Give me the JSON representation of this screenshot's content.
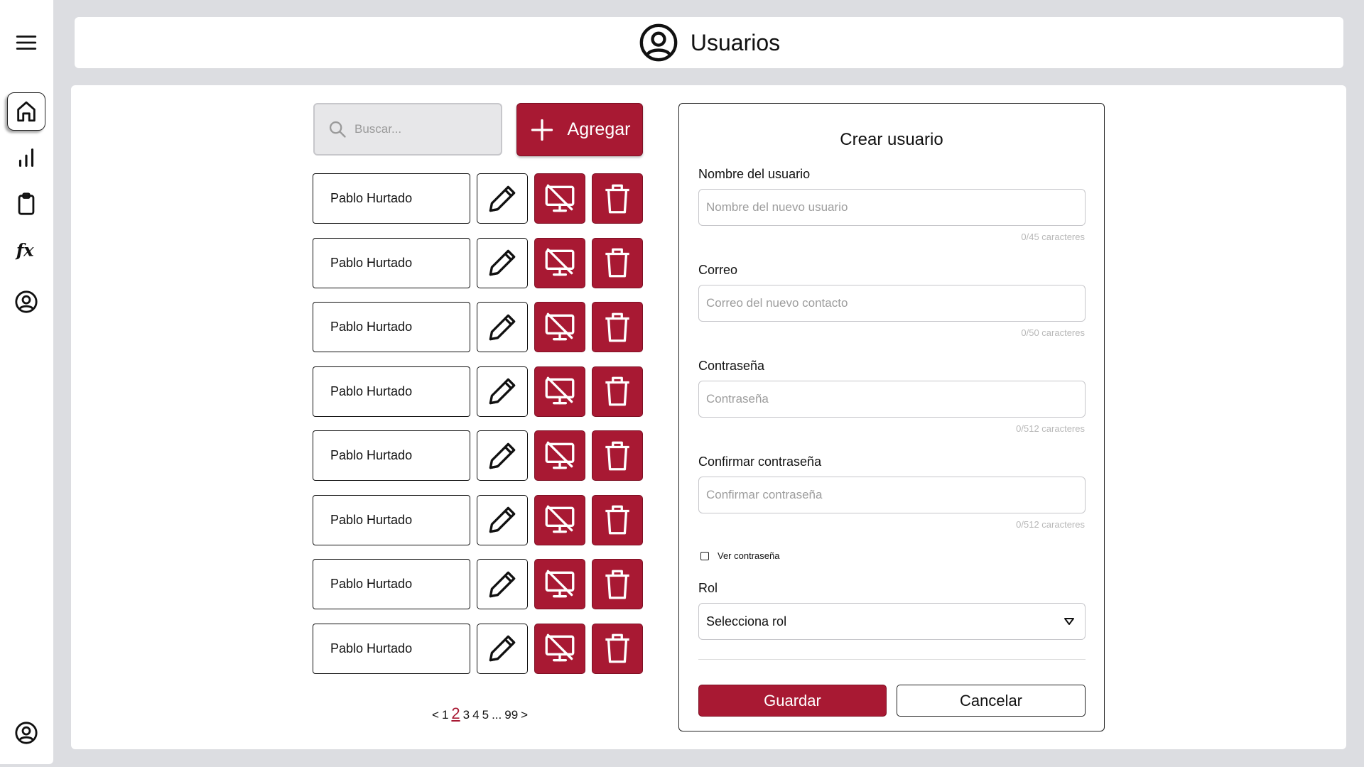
{
  "header": {
    "title": "Usuarios",
    "icon": "user-circle-icon"
  },
  "sidebar": {
    "items": [
      {
        "name": "menu",
        "icon": "hamburger-icon"
      },
      {
        "name": "home",
        "icon": "home-icon",
        "active": true
      },
      {
        "name": "stats",
        "icon": "bar-chart-icon"
      },
      {
        "name": "clipboard",
        "icon": "clipboard-icon"
      },
      {
        "name": "formulas",
        "icon": "function-icon"
      },
      {
        "name": "users",
        "icon": "user-circle-icon"
      },
      {
        "name": "profile",
        "icon": "user-circle-icon"
      }
    ]
  },
  "toolbar": {
    "search_placeholder": "Buscar...",
    "add_label": "Agregar"
  },
  "users": [
    {
      "name": "Pablo Hurtado"
    },
    {
      "name": "Pablo Hurtado"
    },
    {
      "name": "Pablo Hurtado"
    },
    {
      "name": "Pablo Hurtado"
    },
    {
      "name": "Pablo Hurtado"
    },
    {
      "name": "Pablo Hurtado"
    },
    {
      "name": "Pablo Hurtado"
    },
    {
      "name": "Pablo Hurtado"
    }
  ],
  "pagination": {
    "prev": "<",
    "pages": [
      "1",
      "2",
      "3",
      "4",
      "5"
    ],
    "current": "2",
    "ellipsis": "...",
    "last": "99",
    "next": ">"
  },
  "form": {
    "title": "Crear usuario",
    "name": {
      "label": "Nombre del usuario",
      "placeholder": "Nombre del nuevo usuario",
      "counter": "0/45 caracteres"
    },
    "email": {
      "label": "Correo",
      "placeholder": "Correo del nuevo contacto",
      "counter": "0/50 caracteres"
    },
    "password": {
      "label": "Contraseña",
      "placeholder": "Contraseña",
      "counter": "0/512 caracteres"
    },
    "confirm": {
      "label": "Confirmar contraseña",
      "placeholder": "Confirmar contraseña",
      "counter": "0/512 caracteres"
    },
    "show_password": "Ver contraseña",
    "role": {
      "label": "Rol",
      "value": "Selecciona rol"
    },
    "save_label": "Guardar",
    "cancel_label": "Cancelar"
  },
  "colors": {
    "accent": "#a81933",
    "background": "#dcdde1",
    "panel": "#ffffff"
  }
}
